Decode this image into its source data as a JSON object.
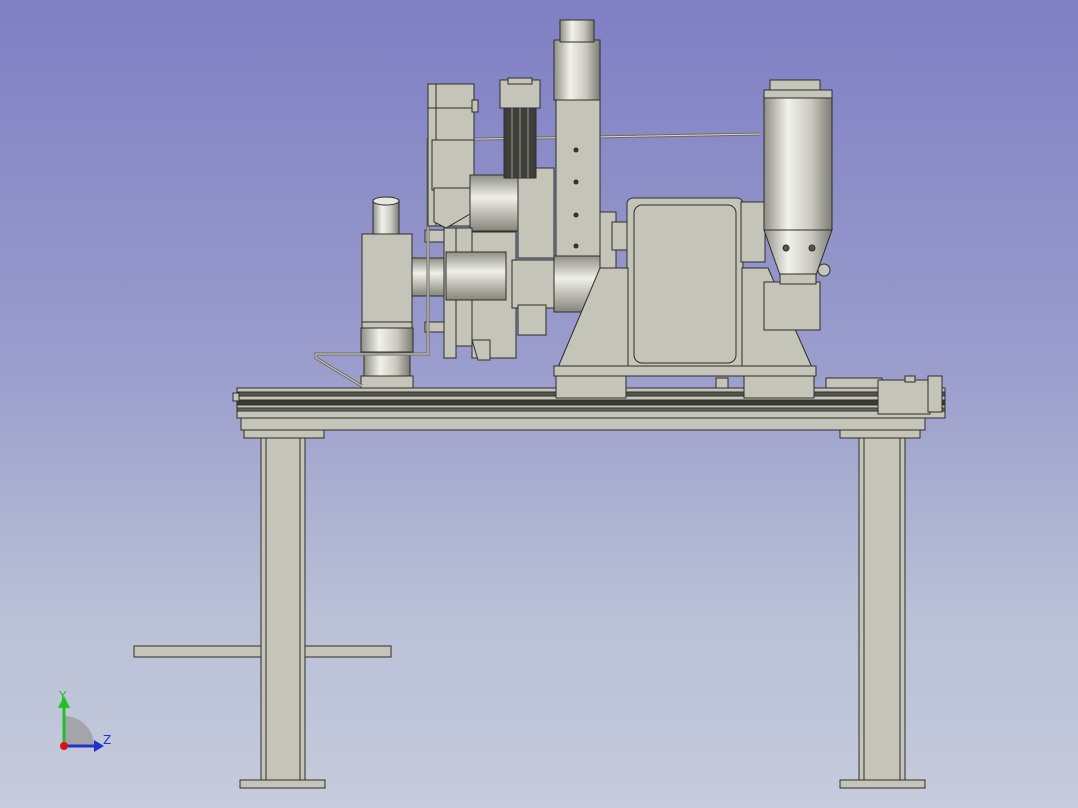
{
  "viewport": {
    "background_top": "#7f7fc4",
    "background_bottom": "#c6ccdc",
    "part_fill": "#c4c4b8",
    "part_edge": "#2e2e2a"
  },
  "axis_triad": {
    "y_label": "Y",
    "z_label": "Z",
    "y_color": "#22c022",
    "z_color": "#2233cc",
    "x_color": "#dd1111",
    "icons": [
      "y-axis-arrow-icon",
      "z-axis-arrow-icon",
      "x-axis-origin-icon"
    ]
  }
}
